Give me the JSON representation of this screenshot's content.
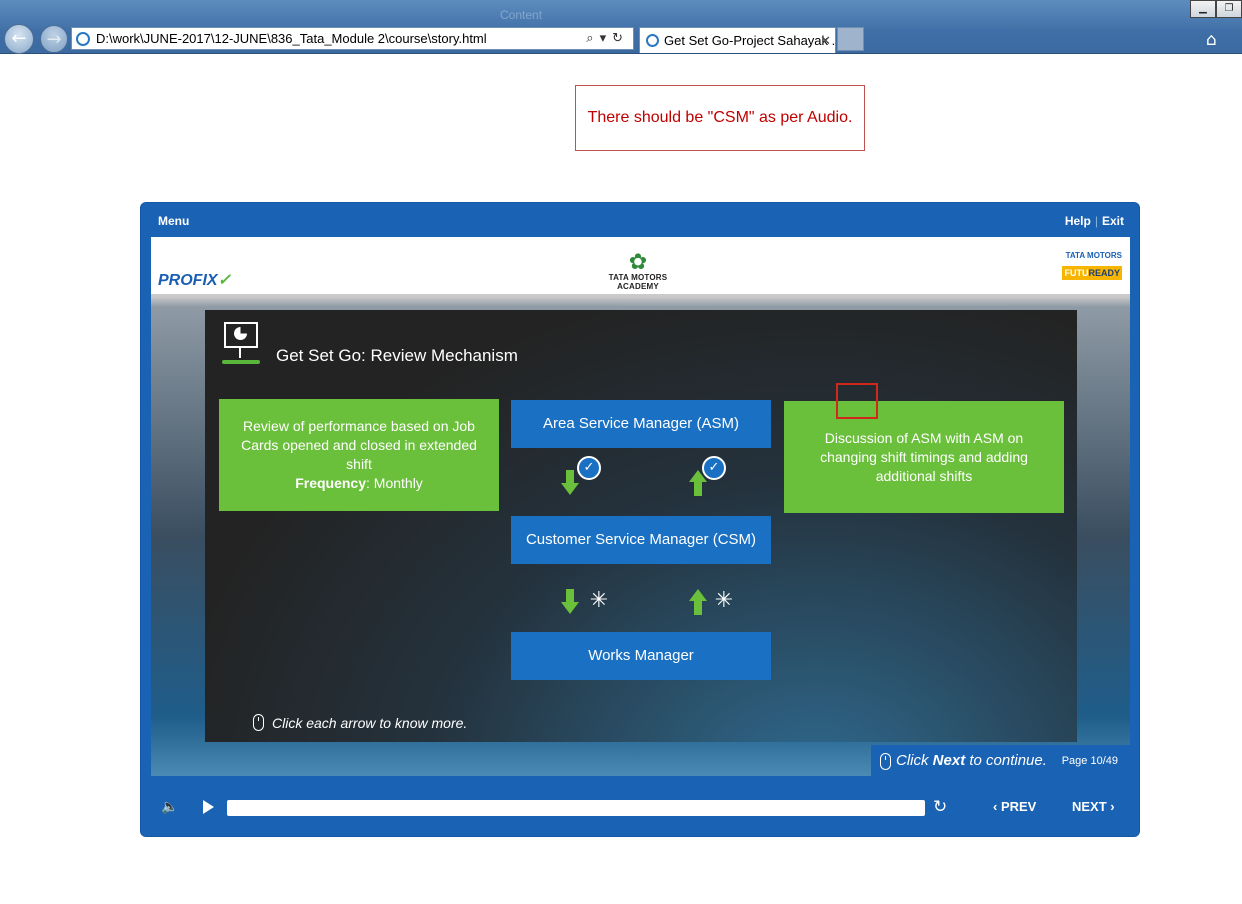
{
  "browser": {
    "address": "D:\\work\\JUNE-2017\\12-JUNE\\836_Tata_Module 2\\course\\story.html",
    "tab_title": "Get Set Go-Project Sahayak ...",
    "tab_close": "✕",
    "back_glyph": "←",
    "forward_glyph": "→",
    "home_glyph": "⌂",
    "addr_tools": "⌕▾↻",
    "window_controls": [
      "▁",
      "❐"
    ]
  },
  "player": {
    "menu_label": "Menu",
    "help_label": "Help",
    "separator": "|",
    "exit_label": "Exit",
    "profix_logo": "PROFIX",
    "academy_logo": "TATA MOTORS ACADEMY",
    "tata_logo": "TATA MOTORS",
    "futu_logo_a": "FUTU",
    "futu_logo_b": "READY"
  },
  "slide": {
    "title": "Get Set Go: Review Mechanism",
    "left_box": {
      "line": "Review of performance based on Job Cards opened and closed in extended shift",
      "freq_label": "Frequency",
      "freq_value": ": Monthly"
    },
    "right_box": "Discussion of ASM with ASM on changing shift timings and adding additional shifts",
    "boxes": [
      "Area Service Manager (ASM)",
      "Customer Service Manager (CSM)",
      "Works Manager"
    ],
    "check_glyph": "✓",
    "click_glyph": "✳",
    "hint": "Click each arrow to know more."
  },
  "annotation": {
    "text": "There should be \"CSM\" as per Audio."
  },
  "footer": {
    "next_prefix": "Click ",
    "next_bold": "Next",
    "next_suffix": " to continue.",
    "page": "Page 10/49",
    "volume_glyph": "🔈",
    "replay_glyph": "↻",
    "prev_label": "‹  PREV",
    "next_label": "NEXT  ›"
  },
  "colors": {
    "player_blue": "#1a62b3",
    "box_blue": "#1a70c2",
    "box_green": "#6abf3b",
    "annotation_red": "#c00000"
  }
}
